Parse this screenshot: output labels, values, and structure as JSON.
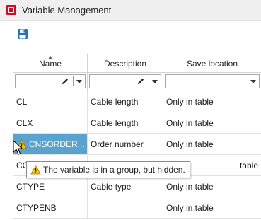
{
  "window": {
    "title": "Variable Management"
  },
  "toolbar": {
    "save_icon": "floppy-disk-icon"
  },
  "columns": [
    "Name",
    "Description",
    "Save location"
  ],
  "filter": {
    "name_value": "",
    "description_value": "",
    "save_location_value": ""
  },
  "rows": [
    {
      "name": "CL",
      "description": "Cable length",
      "save_location": "Only in table",
      "warning": false
    },
    {
      "name": "CLX",
      "description": "Cable length",
      "save_location": "Only in table",
      "warning": false
    },
    {
      "name": "CNSORDER...",
      "description": "Order number",
      "save_location": "Only in table",
      "warning": true,
      "selected": true
    },
    {
      "name": "CO",
      "description": "",
      "save_location": "table",
      "warning": false
    },
    {
      "name": "CTYPE",
      "description": "Cable type",
      "save_location": "Only in table",
      "warning": false
    },
    {
      "name": "CTYPENB",
      "description": "",
      "save_location": "Only in table",
      "warning": false
    }
  ],
  "tooltip": {
    "text": "The variable is in a group, but hidden."
  },
  "colors": {
    "selected_row": "#5ba3cf",
    "warning": "#f2c418",
    "app_icon": "#c8102e"
  }
}
